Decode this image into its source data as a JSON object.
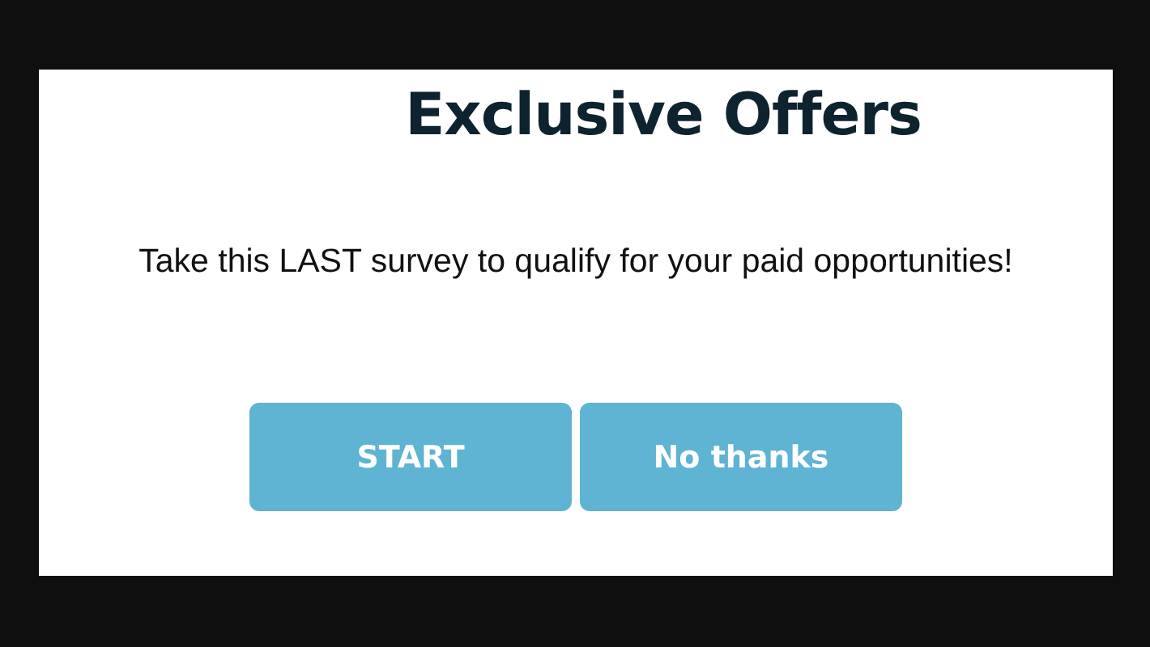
{
  "dialog": {
    "title": "Exclusive Offers",
    "message": "Take this LAST survey to qualify for your paid opportunities!",
    "buttons": [
      "START",
      "No thanks"
    ]
  }
}
